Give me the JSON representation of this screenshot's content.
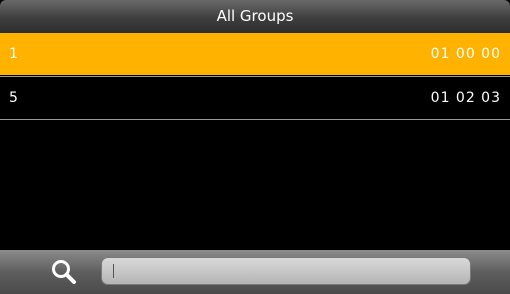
{
  "header": {
    "title": "All Groups"
  },
  "groups": [
    {
      "id": "1",
      "time": "01 00 00",
      "selected": true
    },
    {
      "id": "5",
      "time": "01 02 03",
      "selected": false
    }
  ],
  "search": {
    "value": ""
  },
  "colors": {
    "selected_row": "#ffb300",
    "background": "#000000",
    "text": "#ffffff"
  },
  "icons": {
    "search": "magnifier-icon"
  }
}
